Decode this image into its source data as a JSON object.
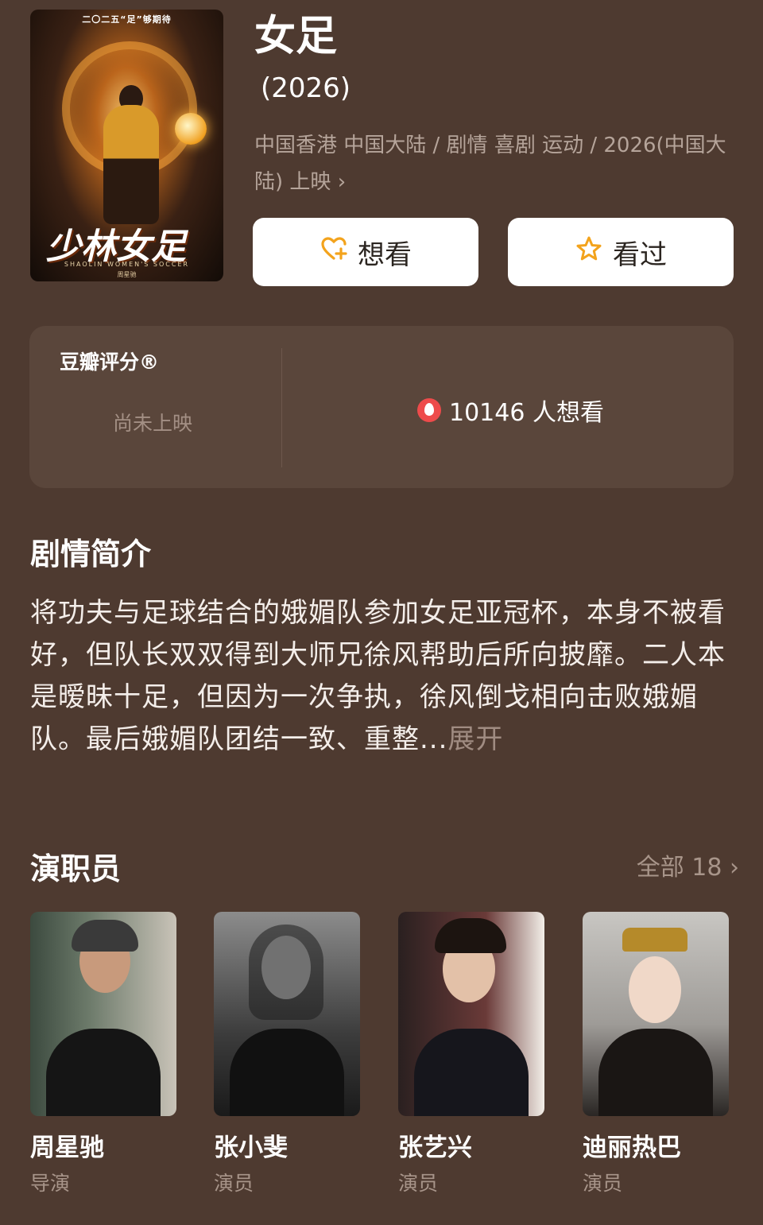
{
  "movie": {
    "title": "女足",
    "year": "(2026)",
    "meta": "中国香港 中国大陆 / 剧情 喜剧 运动 / 2026(中国大陆) 上映",
    "meta_chevron": "›",
    "poster": {
      "top_text": "二〇二五“足”够期待",
      "logo_text": "少林女足",
      "logo_en": "SHAOLIN WOMEN'S SOCCER",
      "credit": "周星驰"
    }
  },
  "actions": {
    "want_label": "想看",
    "seen_label": "看过",
    "want_icon": "heart-plus-icon",
    "seen_icon": "star-icon"
  },
  "rating": {
    "label": "豆瓣评分®",
    "status": "尚未上映",
    "wish_text": "10146 人想看",
    "wish_icon": "fire-icon"
  },
  "synopsis": {
    "title": "剧情简介",
    "text": "将功夫与足球结合的娥媚队参加女足亚冠杯，本身不被看好，但队长双双得到大师兄徐风帮助后所向披靡。二人本是暧昧十足，但因为一次争执，徐风倒戈相向击败娥媚队。最后娥媚队团结一致、重整...",
    "expand": "展开"
  },
  "cast": {
    "title": "演职员",
    "all_label": "全部 18",
    "all_chevron": "›",
    "members": [
      {
        "name": "周星驰",
        "role": "导演"
      },
      {
        "name": "张小斐",
        "role": "演员"
      },
      {
        "name": "张艺兴",
        "role": "演员"
      },
      {
        "name": "迪丽热巴",
        "role": "演员"
      }
    ]
  },
  "colors": {
    "background": "#4e3a30",
    "card": "#5a463b",
    "accent": "#f3a31c",
    "muted": "#a8958a"
  }
}
